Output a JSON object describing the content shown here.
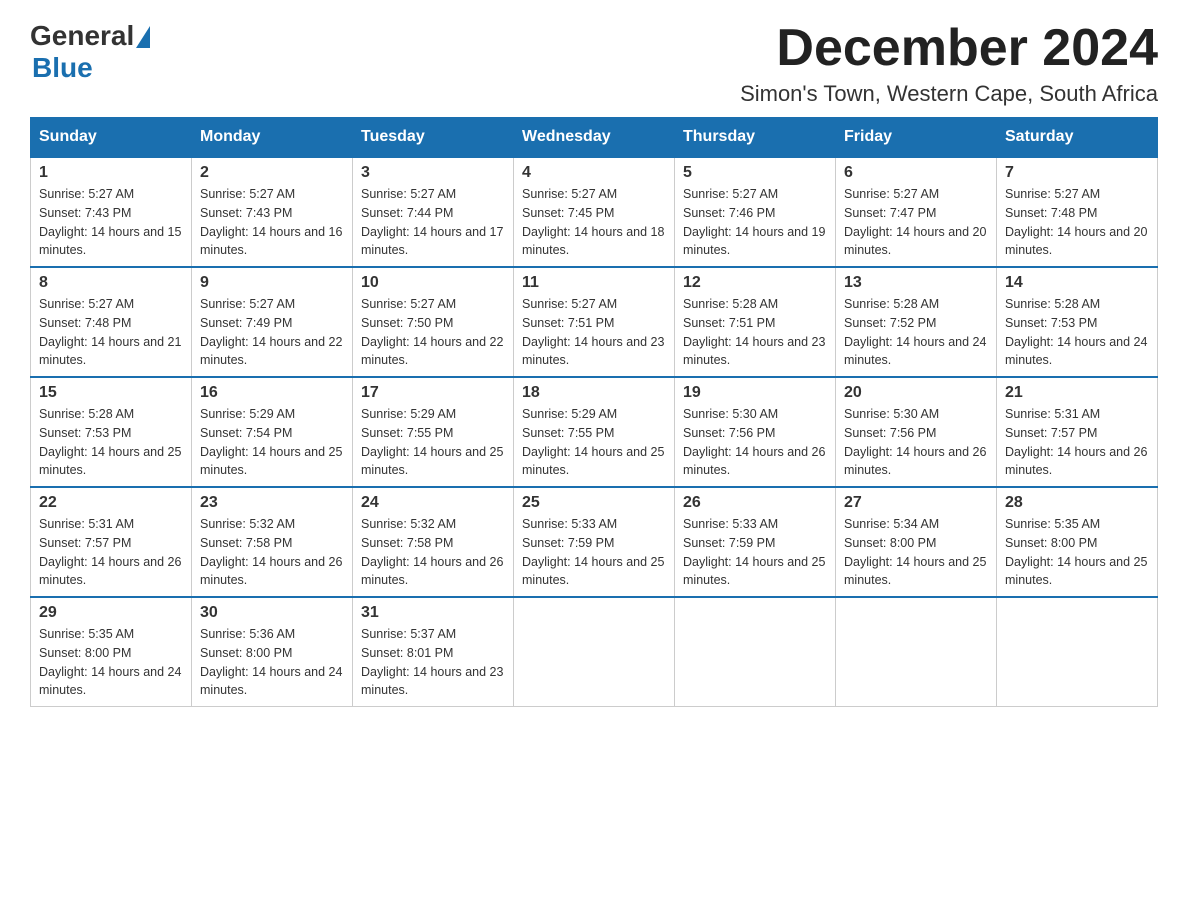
{
  "logo": {
    "general": "General",
    "blue": "Blue"
  },
  "title": "December 2024",
  "location": "Simon's Town, Western Cape, South Africa",
  "weekdays": [
    "Sunday",
    "Monday",
    "Tuesday",
    "Wednesday",
    "Thursday",
    "Friday",
    "Saturday"
  ],
  "weeks": [
    [
      {
        "day": "1",
        "sunrise": "Sunrise: 5:27 AM",
        "sunset": "Sunset: 7:43 PM",
        "daylight": "Daylight: 14 hours and 15 minutes."
      },
      {
        "day": "2",
        "sunrise": "Sunrise: 5:27 AM",
        "sunset": "Sunset: 7:43 PM",
        "daylight": "Daylight: 14 hours and 16 minutes."
      },
      {
        "day": "3",
        "sunrise": "Sunrise: 5:27 AM",
        "sunset": "Sunset: 7:44 PM",
        "daylight": "Daylight: 14 hours and 17 minutes."
      },
      {
        "day": "4",
        "sunrise": "Sunrise: 5:27 AM",
        "sunset": "Sunset: 7:45 PM",
        "daylight": "Daylight: 14 hours and 18 minutes."
      },
      {
        "day": "5",
        "sunrise": "Sunrise: 5:27 AM",
        "sunset": "Sunset: 7:46 PM",
        "daylight": "Daylight: 14 hours and 19 minutes."
      },
      {
        "day": "6",
        "sunrise": "Sunrise: 5:27 AM",
        "sunset": "Sunset: 7:47 PM",
        "daylight": "Daylight: 14 hours and 20 minutes."
      },
      {
        "day": "7",
        "sunrise": "Sunrise: 5:27 AM",
        "sunset": "Sunset: 7:48 PM",
        "daylight": "Daylight: 14 hours and 20 minutes."
      }
    ],
    [
      {
        "day": "8",
        "sunrise": "Sunrise: 5:27 AM",
        "sunset": "Sunset: 7:48 PM",
        "daylight": "Daylight: 14 hours and 21 minutes."
      },
      {
        "day": "9",
        "sunrise": "Sunrise: 5:27 AM",
        "sunset": "Sunset: 7:49 PM",
        "daylight": "Daylight: 14 hours and 22 minutes."
      },
      {
        "day": "10",
        "sunrise": "Sunrise: 5:27 AM",
        "sunset": "Sunset: 7:50 PM",
        "daylight": "Daylight: 14 hours and 22 minutes."
      },
      {
        "day": "11",
        "sunrise": "Sunrise: 5:27 AM",
        "sunset": "Sunset: 7:51 PM",
        "daylight": "Daylight: 14 hours and 23 minutes."
      },
      {
        "day": "12",
        "sunrise": "Sunrise: 5:28 AM",
        "sunset": "Sunset: 7:51 PM",
        "daylight": "Daylight: 14 hours and 23 minutes."
      },
      {
        "day": "13",
        "sunrise": "Sunrise: 5:28 AM",
        "sunset": "Sunset: 7:52 PM",
        "daylight": "Daylight: 14 hours and 24 minutes."
      },
      {
        "day": "14",
        "sunrise": "Sunrise: 5:28 AM",
        "sunset": "Sunset: 7:53 PM",
        "daylight": "Daylight: 14 hours and 24 minutes."
      }
    ],
    [
      {
        "day": "15",
        "sunrise": "Sunrise: 5:28 AM",
        "sunset": "Sunset: 7:53 PM",
        "daylight": "Daylight: 14 hours and 25 minutes."
      },
      {
        "day": "16",
        "sunrise": "Sunrise: 5:29 AM",
        "sunset": "Sunset: 7:54 PM",
        "daylight": "Daylight: 14 hours and 25 minutes."
      },
      {
        "day": "17",
        "sunrise": "Sunrise: 5:29 AM",
        "sunset": "Sunset: 7:55 PM",
        "daylight": "Daylight: 14 hours and 25 minutes."
      },
      {
        "day": "18",
        "sunrise": "Sunrise: 5:29 AM",
        "sunset": "Sunset: 7:55 PM",
        "daylight": "Daylight: 14 hours and 25 minutes."
      },
      {
        "day": "19",
        "sunrise": "Sunrise: 5:30 AM",
        "sunset": "Sunset: 7:56 PM",
        "daylight": "Daylight: 14 hours and 26 minutes."
      },
      {
        "day": "20",
        "sunrise": "Sunrise: 5:30 AM",
        "sunset": "Sunset: 7:56 PM",
        "daylight": "Daylight: 14 hours and 26 minutes."
      },
      {
        "day": "21",
        "sunrise": "Sunrise: 5:31 AM",
        "sunset": "Sunset: 7:57 PM",
        "daylight": "Daylight: 14 hours and 26 minutes."
      }
    ],
    [
      {
        "day": "22",
        "sunrise": "Sunrise: 5:31 AM",
        "sunset": "Sunset: 7:57 PM",
        "daylight": "Daylight: 14 hours and 26 minutes."
      },
      {
        "day": "23",
        "sunrise": "Sunrise: 5:32 AM",
        "sunset": "Sunset: 7:58 PM",
        "daylight": "Daylight: 14 hours and 26 minutes."
      },
      {
        "day": "24",
        "sunrise": "Sunrise: 5:32 AM",
        "sunset": "Sunset: 7:58 PM",
        "daylight": "Daylight: 14 hours and 26 minutes."
      },
      {
        "day": "25",
        "sunrise": "Sunrise: 5:33 AM",
        "sunset": "Sunset: 7:59 PM",
        "daylight": "Daylight: 14 hours and 25 minutes."
      },
      {
        "day": "26",
        "sunrise": "Sunrise: 5:33 AM",
        "sunset": "Sunset: 7:59 PM",
        "daylight": "Daylight: 14 hours and 25 minutes."
      },
      {
        "day": "27",
        "sunrise": "Sunrise: 5:34 AM",
        "sunset": "Sunset: 8:00 PM",
        "daylight": "Daylight: 14 hours and 25 minutes."
      },
      {
        "day": "28",
        "sunrise": "Sunrise: 5:35 AM",
        "sunset": "Sunset: 8:00 PM",
        "daylight": "Daylight: 14 hours and 25 minutes."
      }
    ],
    [
      {
        "day": "29",
        "sunrise": "Sunrise: 5:35 AM",
        "sunset": "Sunset: 8:00 PM",
        "daylight": "Daylight: 14 hours and 24 minutes."
      },
      {
        "day": "30",
        "sunrise": "Sunrise: 5:36 AM",
        "sunset": "Sunset: 8:00 PM",
        "daylight": "Daylight: 14 hours and 24 minutes."
      },
      {
        "day": "31",
        "sunrise": "Sunrise: 5:37 AM",
        "sunset": "Sunset: 8:01 PM",
        "daylight": "Daylight: 14 hours and 23 minutes."
      },
      null,
      null,
      null,
      null
    ]
  ]
}
